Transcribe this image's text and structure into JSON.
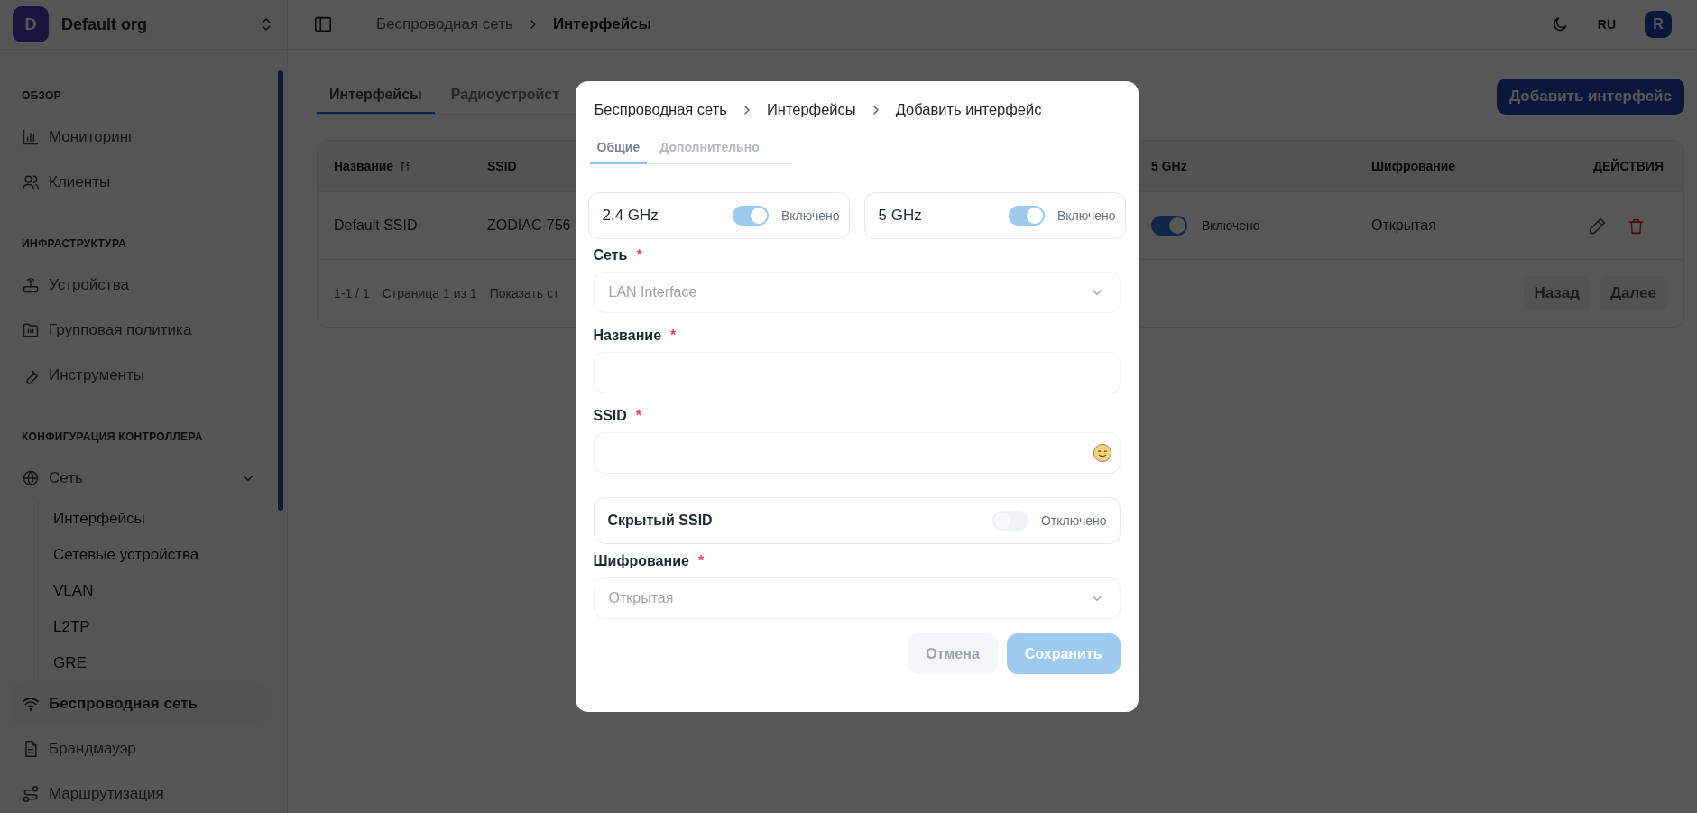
{
  "sidebar": {
    "org": {
      "avatar": "D",
      "name": "Default org"
    },
    "sections": [
      {
        "title": "ОБЗОР",
        "items": [
          {
            "label": "Мониторинг",
            "selected": false
          },
          {
            "label": "Клиенты",
            "selected": false
          }
        ]
      },
      {
        "title": "ИНФРАСТРУКТУРА",
        "items": [
          {
            "label": "Устройства",
            "selected": false
          },
          {
            "label": "Групповая политика",
            "selected": false
          },
          {
            "label": "Инструменты",
            "selected": false
          }
        ]
      },
      {
        "title": "КОНФИГУРАЦИЯ КОНТРОЛЛЕРА",
        "items": [
          {
            "label": "Сеть",
            "selected": false,
            "expanded": true,
            "children": [
              {
                "label": "Интерфейсы",
                "selected": false
              },
              {
                "label": "Сетевые устройства",
                "selected": false
              },
              {
                "label": "VLAN",
                "selected": false
              },
              {
                "label": "L2TP",
                "selected": false
              },
              {
                "label": "GRE",
                "selected": false
              }
            ]
          },
          {
            "label": "Беспроводная сеть",
            "selected": true
          },
          {
            "label": "Брандмауэр",
            "selected": false
          },
          {
            "label": "Маршрутизация",
            "selected": false
          }
        ]
      }
    ]
  },
  "header": {
    "breadcrumb": [
      "Беспроводная сеть",
      "Интерфейсы"
    ],
    "language": "RU",
    "avatar": "R"
  },
  "page_tabs": [
    {
      "label": "Интерфейсы",
      "selected": true
    },
    {
      "label": "Радиоустройст",
      "selected": false
    }
  ],
  "add_button": "Добавить интерфейс",
  "table": {
    "columns": [
      {
        "label": "Название",
        "sortable": true
      },
      {
        "label": "SSID",
        "sortable": false
      },
      {
        "label": "5 GHz",
        "sortable": false
      },
      {
        "label": "Шифрование",
        "sortable": false
      },
      {
        "label": "ДЕЙСТВИЯ",
        "sortable": false
      }
    ],
    "rows": [
      {
        "name": "Default SSID",
        "ssid": "ZODIAC-756",
        "band_5ghz": {
          "on": true,
          "status": "Включено"
        },
        "encryption": "Открытая"
      }
    ],
    "footer": {
      "range": "1-1 / 1",
      "page": "Страница 1 из 1",
      "page_size": "Показать ст",
      "buttons": [
        {
          "label": "Назад",
          "disabled": true
        },
        {
          "label": "Далее",
          "disabled": true
        }
      ]
    }
  },
  "modal": {
    "breadcrumb": [
      "Беспроводная сеть",
      "Интерфейсы",
      "Добавить интерфейс"
    ],
    "tabs": [
      {
        "label": "Общие",
        "selected": true
      },
      {
        "label": "Дополнительно",
        "selected": false
      }
    ],
    "bands": [
      {
        "label": "2.4 GHz",
        "on": true,
        "status": "Включено"
      },
      {
        "label": "5 GHz",
        "on": true,
        "status": "Включено"
      }
    ],
    "fields": [
      {
        "kind": "select",
        "label": "Сеть",
        "marker": "*",
        "value": "LAN Interface",
        "disabled": true
      },
      {
        "kind": "text",
        "label": "Название",
        "marker": "*"
      },
      {
        "kind": "emoji-text",
        "label": "SSID",
        "marker": "*"
      },
      {
        "kind": "toggle",
        "label": "Скрытый SSID",
        "on": false,
        "status": "Отключено"
      },
      {
        "kind": "select",
        "label": "Шифрование",
        "marker": "*",
        "value": "Открытая",
        "disabled": true
      }
    ],
    "buttons": [
      {
        "label": "Отмена",
        "primary": false,
        "disabled": false
      },
      {
        "label": "Сохранить",
        "primary": true,
        "disabled": true
      }
    ]
  }
}
